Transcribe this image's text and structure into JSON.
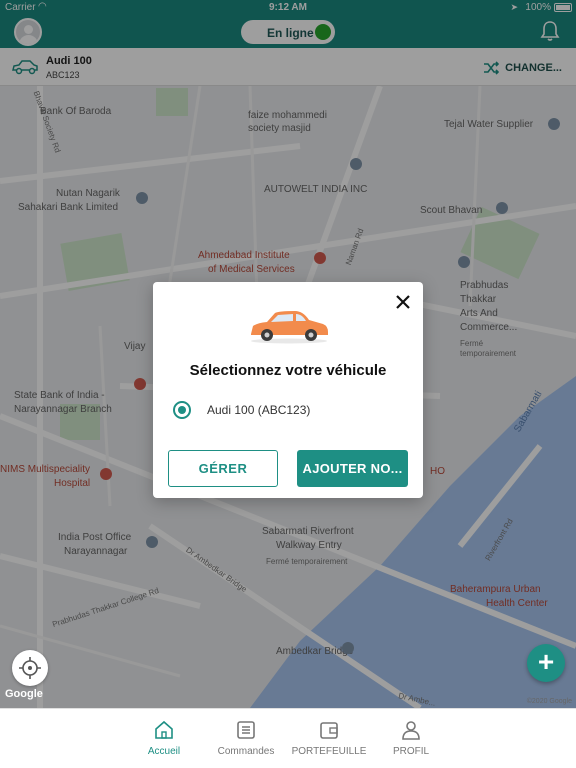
{
  "status_bar": {
    "carrier": "Carrier",
    "time": "9:12 AM",
    "battery": "100%"
  },
  "header": {
    "online_label": "En ligne",
    "accent_color": "#1b8a80",
    "online_color": "#27a52d"
  },
  "vehicle_bar": {
    "name": "Audi 100",
    "plate": "ABC123",
    "change_label": "CHANGE..."
  },
  "map": {
    "places": [
      "Bank Of Baroda",
      "faize mohammedi",
      "society masjid",
      "Tejal Water Supplier",
      "AUTOWELT INDIA INC",
      "Nutan Nagarik",
      "Sahakari Bank Limited",
      "Scout Bhavan",
      "Ahmedabad Institute",
      "of Medical Services",
      "Prabhudas",
      "Thakkar",
      "Arts And",
      "Commerce...",
      "Fermé",
      "temporairement",
      "Vijay",
      "State Bank of India -",
      "Narayannagar Branch",
      "NIMS Multispeciality",
      "Hospital",
      "India Post Office",
      "Narayannagar",
      "Sabarmati Riverfront",
      "Walkway Entry",
      "Fermé temporairement",
      "Baherampura Urban",
      "Health Center",
      "Ambedkar Bridge",
      "Sabarmati",
      "HO"
    ],
    "streets": [
      "Bhavik Society Rd",
      "Naman Rd",
      "Dr Ambedkar Bridge",
      "Prabhudas Thakkar College Rd",
      "Riverfront Rd",
      "Dr Ambe..."
    ],
    "google_label": "Google",
    "copyright": "©2020 Google"
  },
  "modal": {
    "title": "Sélectionnez votre véhicule",
    "option_label": "Audi 100 (ABC123)",
    "manage_label": "GÉRER",
    "add_label": "AJOUTER NO..."
  },
  "fab_label": "+",
  "bottom_nav": {
    "items": [
      {
        "label": "Accueil",
        "icon": "home-icon"
      },
      {
        "label": "Commandes",
        "icon": "orders-icon"
      },
      {
        "label": "PORTEFEUILLE",
        "icon": "wallet-icon"
      },
      {
        "label": "PROFIL",
        "icon": "profile-icon"
      }
    ]
  }
}
